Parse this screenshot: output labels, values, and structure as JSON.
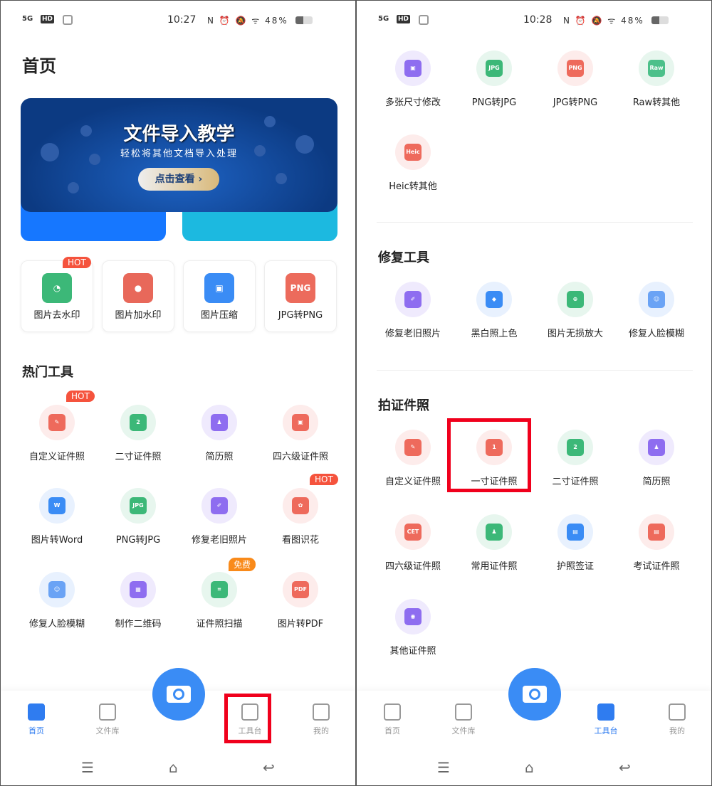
{
  "left": {
    "status": {
      "signal": "5G",
      "hd": "HD",
      "time": "10:27",
      "icons": "N ⏰ 🔕 ᯤ 48%"
    },
    "title": "首页",
    "banner": {
      "title": "文件导入教学",
      "subtitle": "轻松将其他文档导入处理",
      "button": "点击查看 ›"
    },
    "quick": [
      {
        "label": "图片去水印",
        "glyph": "◔",
        "bg": "#3cb878",
        "badge": "HOT"
      },
      {
        "label": "图片加水印",
        "glyph": "●",
        "bg": "#e8685a"
      },
      {
        "label": "图片压缩",
        "glyph": "▣",
        "bg": "#3a8cf5"
      },
      {
        "label": "JPG转PNG",
        "glyph": "PNG",
        "bg": "#ec6b5c"
      }
    ],
    "section": "热门工具",
    "tools": [
      {
        "label": "自定义证件照",
        "glyph": "✎",
        "bg": "#fdeceb",
        "fg": "#ee6a5c",
        "badge": "HOT"
      },
      {
        "label": "二寸证件照",
        "glyph": "2",
        "bg": "#e7f6ee",
        "fg": "#3cb878"
      },
      {
        "label": "简历照",
        "glyph": "♟",
        "bg": "#efeafd",
        "fg": "#8e6df0"
      },
      {
        "label": "四六级证件照",
        "glyph": "▣",
        "bg": "#fdeceb",
        "fg": "#ee6a5c"
      },
      {
        "label": "图片转Word",
        "glyph": "W",
        "bg": "#e8f1fe",
        "fg": "#3a8cf5"
      },
      {
        "label": "PNG转JPG",
        "glyph": "JPG",
        "bg": "#e7f6ee",
        "fg": "#3cb878"
      },
      {
        "label": "修复老旧照片",
        "glyph": "✐",
        "bg": "#efeafd",
        "fg": "#8e6df0"
      },
      {
        "label": "看图识花",
        "glyph": "✿",
        "bg": "#fdeceb",
        "fg": "#ee6a5c",
        "badge": "HOT"
      },
      {
        "label": "修复人脸模糊",
        "glyph": "☺",
        "bg": "#e8f1fe",
        "fg": "#6aa3f5"
      },
      {
        "label": "制作二维码",
        "glyph": "▦",
        "bg": "#efeafd",
        "fg": "#8e6df0"
      },
      {
        "label": "证件照扫描",
        "glyph": "⌗",
        "bg": "#e7f6ee",
        "fg": "#3cb878",
        "badge": "免费",
        "badge_color": "#f98a1a"
      },
      {
        "label": "图片转PDF",
        "glyph": "PDF",
        "bg": "#fdeceb",
        "fg": "#ee6a5c"
      }
    ],
    "nav": [
      {
        "label": "首页",
        "active": true
      },
      {
        "label": "文件库"
      },
      {
        "label": "工具台"
      },
      {
        "label": "我的"
      }
    ]
  },
  "right": {
    "status": {
      "signal": "5G",
      "hd": "HD",
      "time": "10:28",
      "icons": "N ⏰ 🔕 ᯤ 48%"
    },
    "convert": [
      {
        "label": "多张尺寸修改",
        "glyph": "▣",
        "bg": "#efeafd",
        "fg": "#8e6df0"
      },
      {
        "label": "PNG转JPG",
        "glyph": "JPG",
        "bg": "#e7f6ee",
        "fg": "#3cb878"
      },
      {
        "label": "JPG转PNG",
        "glyph": "PNG",
        "bg": "#fdeceb",
        "fg": "#ee6a5c"
      },
      {
        "label": "Raw转其他",
        "glyph": "Raw",
        "bg": "#e7f6ee",
        "fg": "#4cc08a"
      },
      {
        "label": "Heic转其他",
        "glyph": "Heic",
        "bg": "#fdeceb",
        "fg": "#ee6a5c"
      }
    ],
    "repair_title": "修复工具",
    "repair": [
      {
        "label": "修复老旧照片",
        "glyph": "✐",
        "bg": "#efeafd",
        "fg": "#8e6df0"
      },
      {
        "label": "黑白照上色",
        "glyph": "◆",
        "bg": "#e8f1fe",
        "fg": "#3a8cf5"
      },
      {
        "label": "图片无损放大",
        "glyph": "⊕",
        "bg": "#e7f6ee",
        "fg": "#3cb878"
      },
      {
        "label": "修复人脸模糊",
        "glyph": "☺",
        "bg": "#e8f1fe",
        "fg": "#6aa3f5"
      }
    ],
    "id_title": "拍证件照",
    "id": [
      {
        "label": "自定义证件照",
        "glyph": "✎",
        "bg": "#fdeceb",
        "fg": "#ee6a5c"
      },
      {
        "label": "一寸证件照",
        "glyph": "1",
        "bg": "#fdeceb",
        "fg": "#ee6a5c"
      },
      {
        "label": "二寸证件照",
        "glyph": "2",
        "bg": "#e7f6ee",
        "fg": "#3cb878"
      },
      {
        "label": "简历照",
        "glyph": "♟",
        "bg": "#efeafd",
        "fg": "#8e6df0"
      },
      {
        "label": "四六级证件照",
        "glyph": "CET",
        "bg": "#fdeceb",
        "fg": "#ee6a5c"
      },
      {
        "label": "常用证件照",
        "glyph": "♟",
        "bg": "#e7f6ee",
        "fg": "#3cb878"
      },
      {
        "label": "护照签证",
        "glyph": "▤",
        "bg": "#e8f1fe",
        "fg": "#3a8cf5"
      },
      {
        "label": "考试证件照",
        "glyph": "▤",
        "bg": "#fdeceb",
        "fg": "#ee6a5c"
      },
      {
        "label": "其他证件照",
        "glyph": "◉",
        "bg": "#efeafd",
        "fg": "#8e6df0"
      }
    ],
    "nav": [
      {
        "label": "首页"
      },
      {
        "label": "文件库"
      },
      {
        "label": "工具台",
        "active": true
      },
      {
        "label": "我的"
      }
    ]
  },
  "colors": {
    "accent": "#3a8cf5",
    "highlight": "#f0001c"
  }
}
